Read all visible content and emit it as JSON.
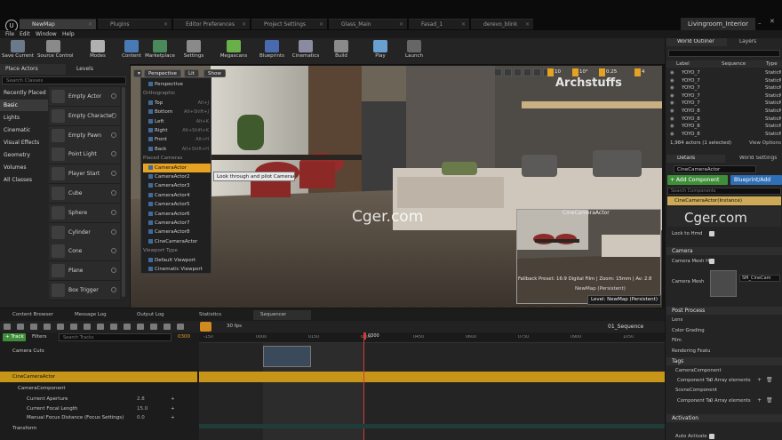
{
  "doc_tabs": [
    {
      "label": "NewMap",
      "active": true
    },
    {
      "label": "Plugins"
    },
    {
      "label": "Editor Preferences"
    },
    {
      "label": "Project Settings"
    },
    {
      "label": "Glass_Main"
    },
    {
      "label": "Fasad_1"
    },
    {
      "label": "derevo_blink"
    }
  ],
  "project_name": "Livingroom_Interior",
  "menu": [
    "File",
    "Edit",
    "Window",
    "Help"
  ],
  "toolbar": [
    {
      "label": "Save Current",
      "color": "#6a7a8a"
    },
    {
      "label": "Source Control",
      "color": "#8a8a8a"
    },
    {
      "label": "Modes",
      "color": "#b0b0b0"
    },
    {
      "label": "Content",
      "color": "#4a7ab5"
    },
    {
      "label": "Marketplace",
      "color": "#4a8a5a"
    },
    {
      "label": "Settings",
      "color": "#8a8a8a"
    },
    {
      "label": "Megascans",
      "color": "#6ab04a"
    },
    {
      "label": "Blueprints",
      "color": "#4a6ab0"
    },
    {
      "label": "Cinematics",
      "color": "#8a8aa0"
    },
    {
      "label": "Build",
      "color": "#8a8a8a"
    },
    {
      "label": "Play",
      "color": "#6aa0d0"
    },
    {
      "label": "Launch",
      "color": "#666666"
    }
  ],
  "left_tabs": {
    "place_actors": "Place Actors",
    "levels": "Levels"
  },
  "search_classes": "Search Classes",
  "categories": [
    "Recently Placed",
    "Basic",
    "Lights",
    "Cinematic",
    "Visual Effects",
    "Geometry",
    "Volumes",
    "All Classes"
  ],
  "place_items": [
    "Empty Actor",
    "Empty Character",
    "Empty Pawn",
    "Point Light",
    "Player Start",
    "Cube",
    "Sphere",
    "Cylinder",
    "Cone",
    "Plane",
    "Box Trigger"
  ],
  "viewport": {
    "perspective": "Perspective",
    "lit": "Lit",
    "show": "Show",
    "snap_values": [
      "10",
      "10°",
      "0.25",
      "4"
    ],
    "menu": [
      {
        "label": "Perspective",
        "key": "",
        "type": "item"
      },
      {
        "label": "Orthographic",
        "key": "",
        "type": "head"
      },
      {
        "label": "Top",
        "key": "Alt+J",
        "type": "item"
      },
      {
        "label": "Bottom",
        "key": "Alt+Shift+J",
        "type": "item"
      },
      {
        "label": "Left",
        "key": "Alt+K",
        "type": "item"
      },
      {
        "label": "Right",
        "key": "Alt+Shift+K",
        "type": "item"
      },
      {
        "label": "Front",
        "key": "Alt+H",
        "type": "item"
      },
      {
        "label": "Back",
        "key": "Alt+Shift+H",
        "type": "item"
      },
      {
        "label": "Placed Cameras",
        "key": "",
        "type": "head"
      },
      {
        "label": "CameraActor",
        "key": "",
        "type": "hl"
      },
      {
        "label": "CameraActor2",
        "key": "",
        "type": "item"
      },
      {
        "label": "CameraActor3",
        "key": "",
        "type": "item"
      },
      {
        "label": "CameraActor4",
        "key": "",
        "type": "item"
      },
      {
        "label": "CameraActor5",
        "key": "",
        "type": "item"
      },
      {
        "label": "CameraActor6",
        "key": "",
        "type": "item"
      },
      {
        "label": "CameraActor7",
        "key": "",
        "type": "item"
      },
      {
        "label": "CameraActor8",
        "key": "",
        "type": "item"
      },
      {
        "label": "CineCameraActor",
        "key": "",
        "type": "item"
      },
      {
        "label": "Viewport Type",
        "key": "",
        "type": "head"
      },
      {
        "label": "Default Viewport",
        "key": "",
        "type": "item"
      },
      {
        "label": "Cinematic Viewport",
        "key": "",
        "type": "item"
      }
    ],
    "tooltip": "Look through and pilot CameraActor",
    "pip_title": "CineCameraActor",
    "pip_info": "Fallback Preset: 16:9 Digital Film | Zoom: 15mm | Av: 2.8",
    "pip_map": "NewMap (Persistent)",
    "level_label": "Level:  NewMap (Persistent)",
    "watermark": "Cger.com",
    "brand": "Archstuffs"
  },
  "outliner": {
    "tab1": "World Outliner",
    "tab2": "Layers",
    "cols": [
      "Label",
      "Sequence",
      "Type"
    ],
    "rows": [
      "YOYO_7",
      "YOYO_7",
      "YOYO_7",
      "YOYO_7",
      "YOYO_7",
      "YOYO_8",
      "YOYO_8",
      "YOYO_8",
      "YOYO_8"
    ],
    "row_type": "StaticM",
    "count": "1,984 actors (1 selected)",
    "view_options": "View Options"
  },
  "details": {
    "tab1": "Details",
    "tab2": "World Settings",
    "name": "CineCameraActor",
    "add_component": "+ Add Component",
    "blueprint": "Blueprint/Add",
    "search": "Search Components",
    "instance": "CineCameraActor(Instance)",
    "lock_to_hmd": "Lock to Hmd",
    "sec_camera": "Camera",
    "camera_mesh_hidden": "Camera Mesh Hi",
    "camera_mesh": "Camera Mesh",
    "mesh_value": "SM_CineCam",
    "sec_post": "Post Process",
    "post_items": [
      "Lens",
      "Color Grading",
      "Film",
      "Rendering Featu"
    ],
    "sec_tags": "Tags",
    "camera_component": "CameraComponent",
    "component_tags": "Component Ta",
    "array_elements": "0 Array elements",
    "scene_component": "SceneComponent",
    "sec_activation": "Activation",
    "auto_activate": "Auto Activate"
  },
  "bottom_tabs": [
    "Content Browser",
    "Message Log",
    "Output Log",
    "Statistics",
    "Sequencer"
  ],
  "sequencer": {
    "fps": "30 fps",
    "sequence_name": "01_Sequence",
    "track_btn": "+ Track",
    "filters": "Filters",
    "search_tracks": "Search Tracks",
    "frame": "0300",
    "playhead": "0300",
    "ruler": [
      "-150",
      "0000",
      "0150",
      "0300",
      "0450",
      "0600",
      "0750",
      "0900",
      "1050"
    ],
    "tracks": [
      {
        "label": "Camera Cuts",
        "value": ""
      },
      {
        "label": "CineCameraActor",
        "value": ""
      },
      {
        "label": "CameraComponent",
        "value": ""
      },
      {
        "label": "Current Aperture",
        "value": "2.8"
      },
      {
        "label": "Current Focal Length",
        "value": "15.0"
      },
      {
        "label": "Manual Focus Distance (Focus Settings)",
        "value": "0.0"
      },
      {
        "label": "Transform",
        "value": ""
      }
    ]
  },
  "colors": {
    "accent": "#e6a222",
    "green": "#4caf50",
    "blue": "#2f6fb5"
  }
}
